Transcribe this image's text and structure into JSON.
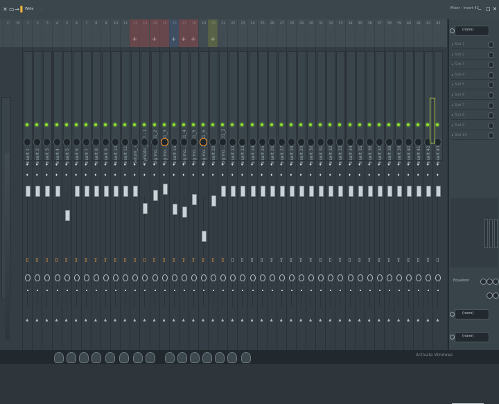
{
  "window": {
    "mode_label": "Wide",
    "title": "Mixer - Insert 42",
    "separator": "‹"
  },
  "insert_numbers": [
    "C",
    "M",
    "1",
    "2",
    "3",
    "4",
    "5",
    "6",
    "7",
    "8",
    "9",
    "10",
    "11",
    "12",
    "13",
    "14",
    "15",
    "16",
    "17",
    "18",
    "19",
    "20",
    "21",
    "22",
    "23",
    "24",
    "25",
    "26",
    "27",
    "28",
    "29",
    "30",
    "31",
    "32",
    "33",
    "34",
    "35",
    "36",
    "37",
    "38",
    "39",
    "40",
    "41",
    "42",
    "43"
  ],
  "strip_names": [
    "Master",
    "Insert 1",
    "Insert 2",
    "Insert 3",
    "Insert 4",
    "Insert 5",
    "Insert 6",
    "Insert 7",
    "Insert 8",
    "Insert 9",
    "Insert 10",
    "Insert 11",
    "Serum_ #4",
    "Cymatic_08 7 - 1",
    "big mo...ec 31_2",
    "big mo...ec 31_3",
    "Insert 15",
    "big mo...ec 31_4",
    "big mo...ec 31_5",
    "big mo...ec 31_6",
    "Insert 20",
    "big mo...on_01_2",
    "Insert 22",
    "Insert 23",
    "Insert 24",
    "Insert 25",
    "Insert 26",
    "Insert 27",
    "Insert 28",
    "Insert 29",
    "Insert 30",
    "Insert 31",
    "Insert 32",
    "Insert 33",
    "Insert 34",
    "Insert 35",
    "Insert 36",
    "Insert 37",
    "Insert 38",
    "Insert 39",
    "Insert 40",
    "Insert 41",
    "Insert 42",
    "Insert 43"
  ],
  "colors": {
    "red_highlight": "#a54343",
    "blue_highlight": "#40557f",
    "olive_highlight": "#7d8a35",
    "led_green": "#8fe22b",
    "knob_orange": "#ff9a2e",
    "selection_green": "#b5d34a"
  },
  "panel": {
    "input_value": "(none)",
    "slots": [
      "Slot 1",
      "Slot 2",
      "Slot 3",
      "Slot 4",
      "Slot 5",
      "Slot 6",
      "Slot 7",
      "Slot 8",
      "Slot 9",
      "Slot 10"
    ],
    "equalizer_label": "Equalizer",
    "output_top": "(none)",
    "output_bottom": "(none)"
  },
  "taskbar": {
    "watermark": "Activate Windows"
  },
  "icons": [
    "close-icon",
    "window-icon",
    "pin-icon",
    "play-icon",
    "minimize-icon",
    "maximize-icon",
    "close-icon",
    "plus-icon",
    "power-icon"
  ]
}
